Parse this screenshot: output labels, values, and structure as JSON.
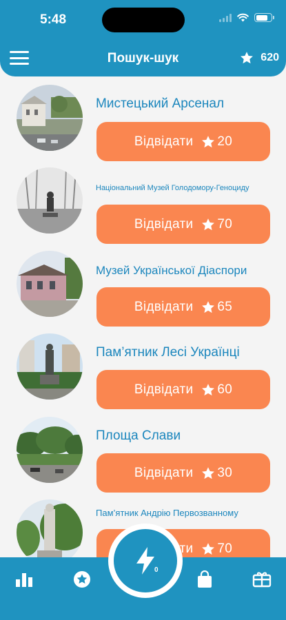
{
  "status_bar": {
    "time": "5:48"
  },
  "header": {
    "title": "Пошук-шук",
    "score": "620"
  },
  "places": [
    {
      "name": "Мистецький Арсенал",
      "visit_label": "Відвідати",
      "points": "20"
    },
    {
      "name": "Національний Музей Голодомору-Геноциду",
      "visit_label": "Відвідати",
      "points": "70"
    },
    {
      "name": "Музей Української Діаспори",
      "visit_label": "Відвідати",
      "points": "65"
    },
    {
      "name": "Пам’ятник Лесі Українці",
      "visit_label": "Відвідати",
      "points": "60"
    },
    {
      "name": "Площа Слави",
      "visit_label": "Відвідати",
      "points": "30"
    },
    {
      "name": "Пам’ятник Андрію Первозванному",
      "visit_label": "Відвідати",
      "points": "70"
    }
  ],
  "tabbar": {
    "energy_count": "0"
  },
  "colors": {
    "primary": "#1f93c0",
    "accent": "#fa8650",
    "title_text": "#1b86bd"
  }
}
